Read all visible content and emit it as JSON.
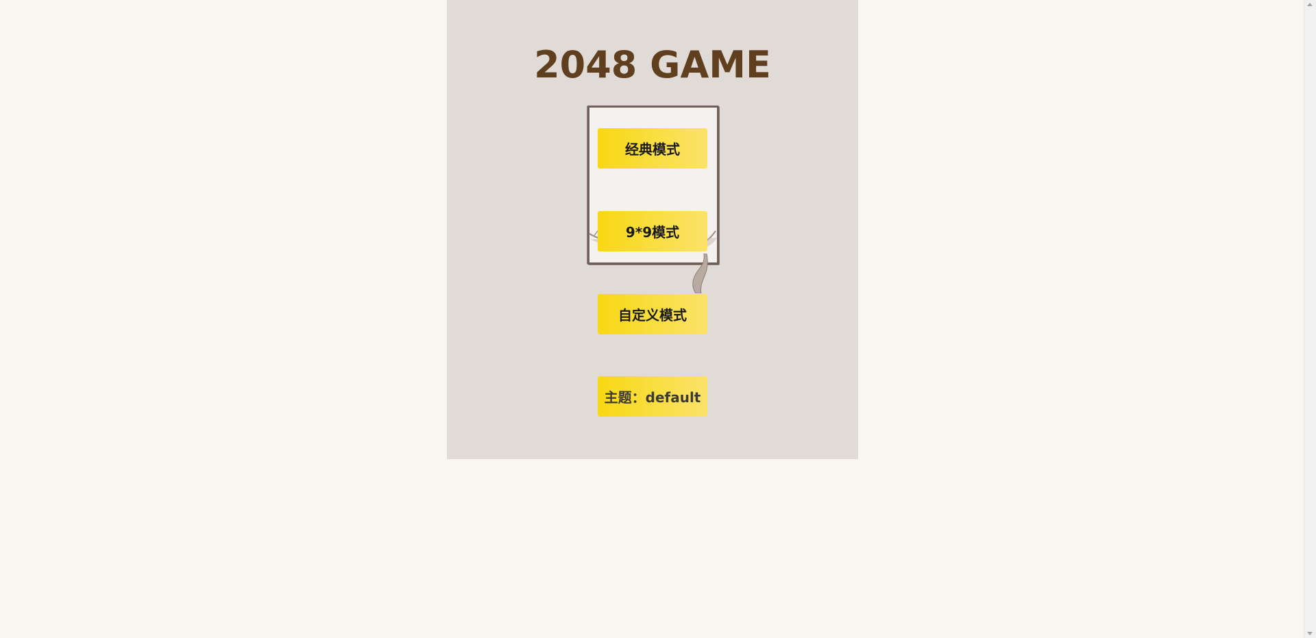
{
  "game": {
    "title": "2048 GAME"
  },
  "menu": {
    "classic_label": "经典模式",
    "nine_label": "9*9模式",
    "custom_label": "自定义模式",
    "theme_label": "主题：default"
  },
  "colors": {
    "page_background": "#f9f6f0",
    "panel_background": "#e0dbd6",
    "title_color": "#603f1f",
    "button_gradient_start": "#f7d812",
    "button_gradient_end": "#fbe36a"
  },
  "icons": {
    "illustration": "cat-frame-illustration"
  }
}
